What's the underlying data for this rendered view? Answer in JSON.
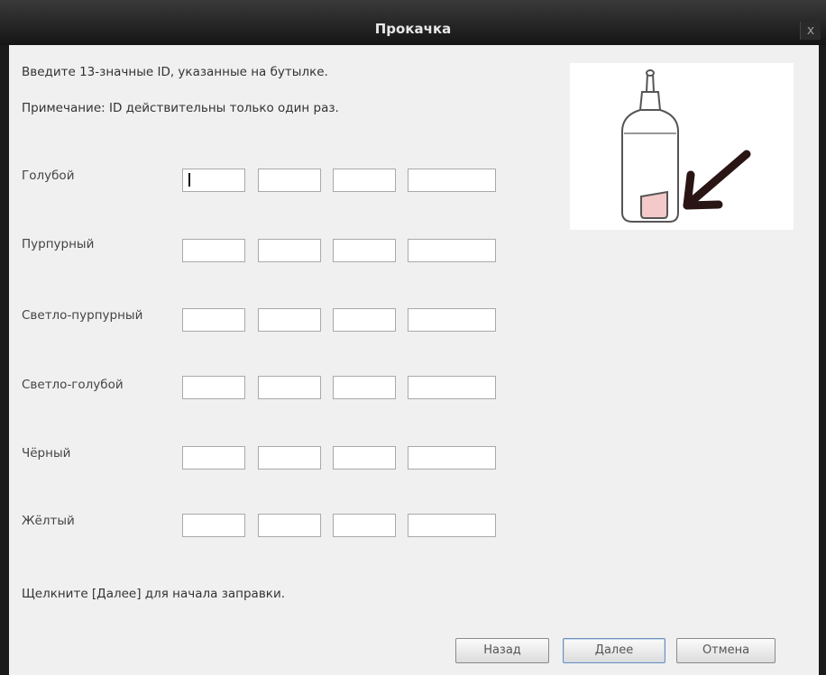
{
  "window": {
    "title": "Прокачка",
    "close_glyph": "x"
  },
  "instructions": {
    "line1": "Введите 13-значные ID, указанные на бутылке.",
    "line2": "Примечание: ID действительны только один раз."
  },
  "inks": [
    {
      "label": "Голубой",
      "fields": [
        "",
        "",
        "",
        ""
      ]
    },
    {
      "label": "Пурпурный",
      "fields": [
        "",
        "",
        "",
        ""
      ]
    },
    {
      "label": "Светло-пурпурный",
      "fields": [
        "",
        "",
        "",
        ""
      ]
    },
    {
      "label": "Светло-голубой",
      "fields": [
        "",
        "",
        "",
        ""
      ]
    },
    {
      "label": "Чёрный",
      "fields": [
        "",
        "",
        "",
        ""
      ]
    },
    {
      "label": "Жёлтый",
      "fields": [
        "",
        "",
        "",
        ""
      ]
    }
  ],
  "footer_text": "Щелкните [Далее] для начала заправки.",
  "buttons": {
    "back": "Назад",
    "next": "Далее",
    "cancel": "Отмена"
  },
  "illustration": {
    "icon": "ink-bottle-icon",
    "arrow": "arrow-icon",
    "ink_color": "#f4c9c9"
  }
}
